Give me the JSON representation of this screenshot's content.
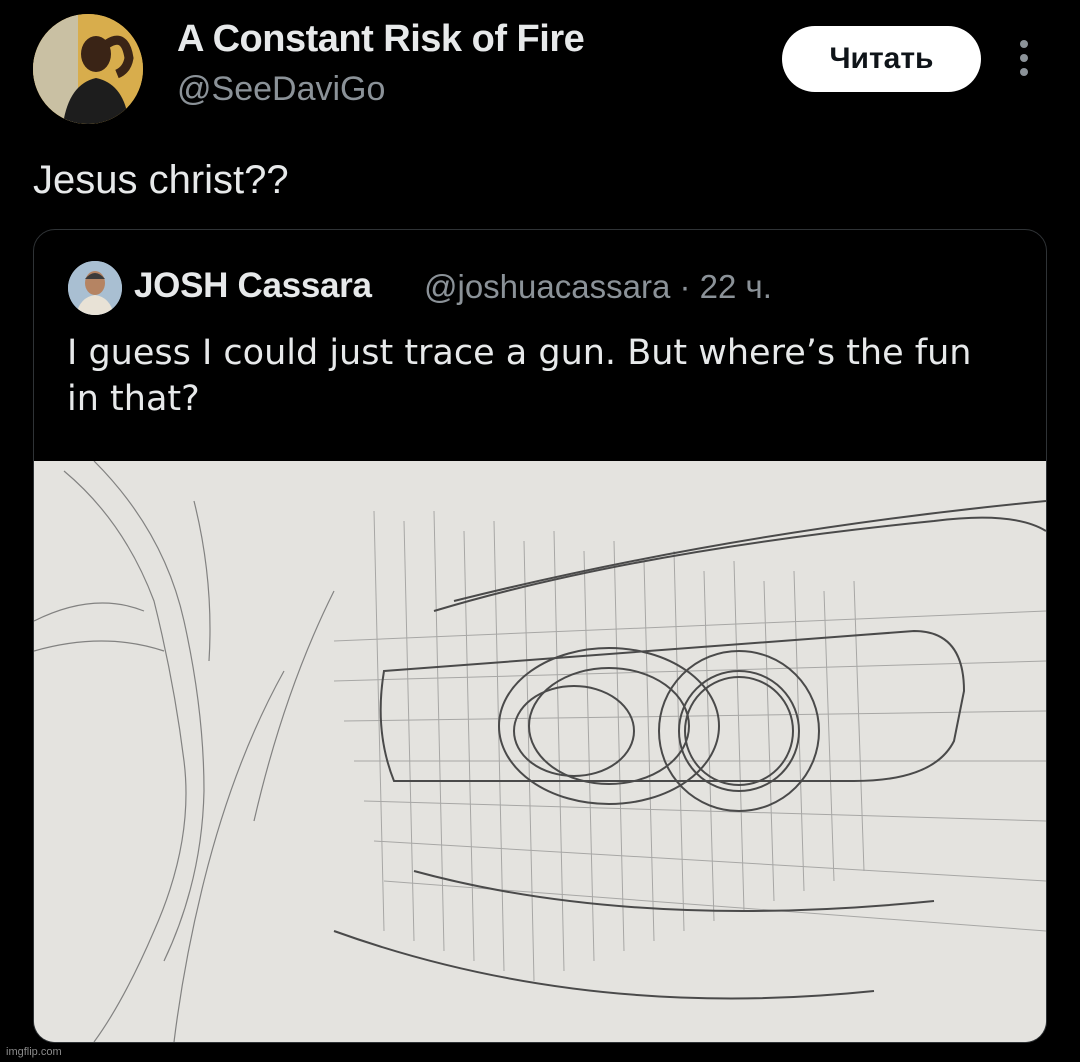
{
  "tweet": {
    "author_name": "A Constant Risk of Fire",
    "author_handle": "@SeeDaviGo",
    "follow_label": "Читать",
    "text": "Jesus christ??"
  },
  "quoted_tweet": {
    "author_name": "JOSH Cassara",
    "author_handle": "@joshuacassara",
    "separator": "·",
    "time": "22 ч.",
    "text": "I guess I could just trace a gun.  But where’s the fun in that?"
  },
  "watermark": "imgflip.com",
  "icons": {
    "more": "more-vertical-icon"
  },
  "colors": {
    "background": "#000000",
    "text_primary": "#e7e9ea",
    "text_secondary": "#8b9298",
    "follow_button_bg": "#ffffff",
    "follow_button_text": "#0f1419",
    "card_border": "#2f3336"
  }
}
